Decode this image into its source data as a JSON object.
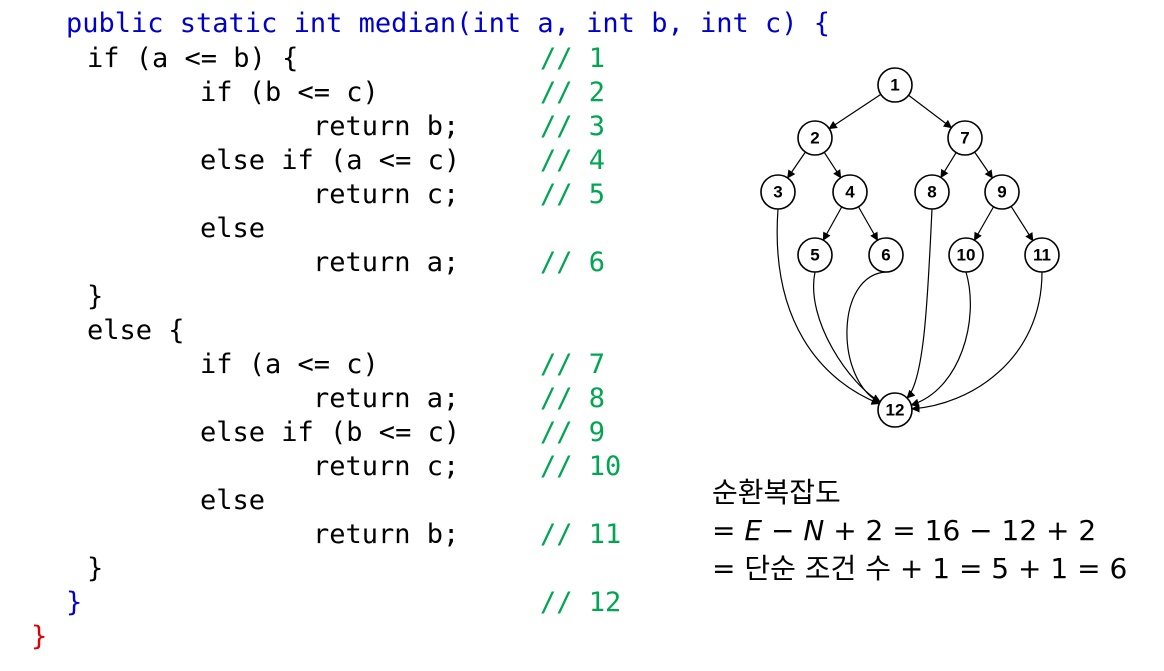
{
  "code": {
    "signature": "public static int median(int a, int b, int c) {",
    "lines": [
      "if (a <= b) {",
      "if (b <= c)",
      "return b;",
      "else if (a <= c)",
      "return c;",
      "else",
      "return a;",
      "}",
      "else {",
      "if (a <= c)",
      "return a;",
      "else if (b <= c)",
      "return c;",
      "else",
      "return b;",
      "}",
      "}",
      "}"
    ],
    "comments": [
      "// 1",
      "// 2",
      "// 3",
      "// 4",
      "// 5",
      "// 6",
      "// 7",
      "// 8",
      "// 9",
      "// 10",
      "// 11",
      "// 12"
    ]
  },
  "graph": {
    "nodes": [
      "1",
      "2",
      "3",
      "4",
      "5",
      "6",
      "7",
      "8",
      "9",
      "10",
      "11",
      "12"
    ],
    "edges": [
      [
        "1",
        "2"
      ],
      [
        "1",
        "7"
      ],
      [
        "2",
        "3"
      ],
      [
        "2",
        "4"
      ],
      [
        "4",
        "5"
      ],
      [
        "4",
        "6"
      ],
      [
        "7",
        "8"
      ],
      [
        "7",
        "9"
      ],
      [
        "9",
        "10"
      ],
      [
        "9",
        "11"
      ],
      [
        "3",
        "12"
      ],
      [
        "5",
        "12"
      ],
      [
        "6",
        "12"
      ],
      [
        "8",
        "12"
      ],
      [
        "10",
        "12"
      ],
      [
        "11",
        "12"
      ]
    ]
  },
  "formula": {
    "title": "순환복잡도",
    "eq1_prefix": "= ",
    "var_e": "E",
    "eq1_mid": " − ",
    "var_n": "N",
    "eq1_rest": " + 2 = 16 − 12 + 2",
    "eq2": "= 단순 조건 수 + 1 = 5 + 1 = 6"
  },
  "colors": {
    "keyword_line": "#0000cc",
    "comment": "#00a651",
    "closing_brace": "#e00000",
    "text": "#000000"
  }
}
